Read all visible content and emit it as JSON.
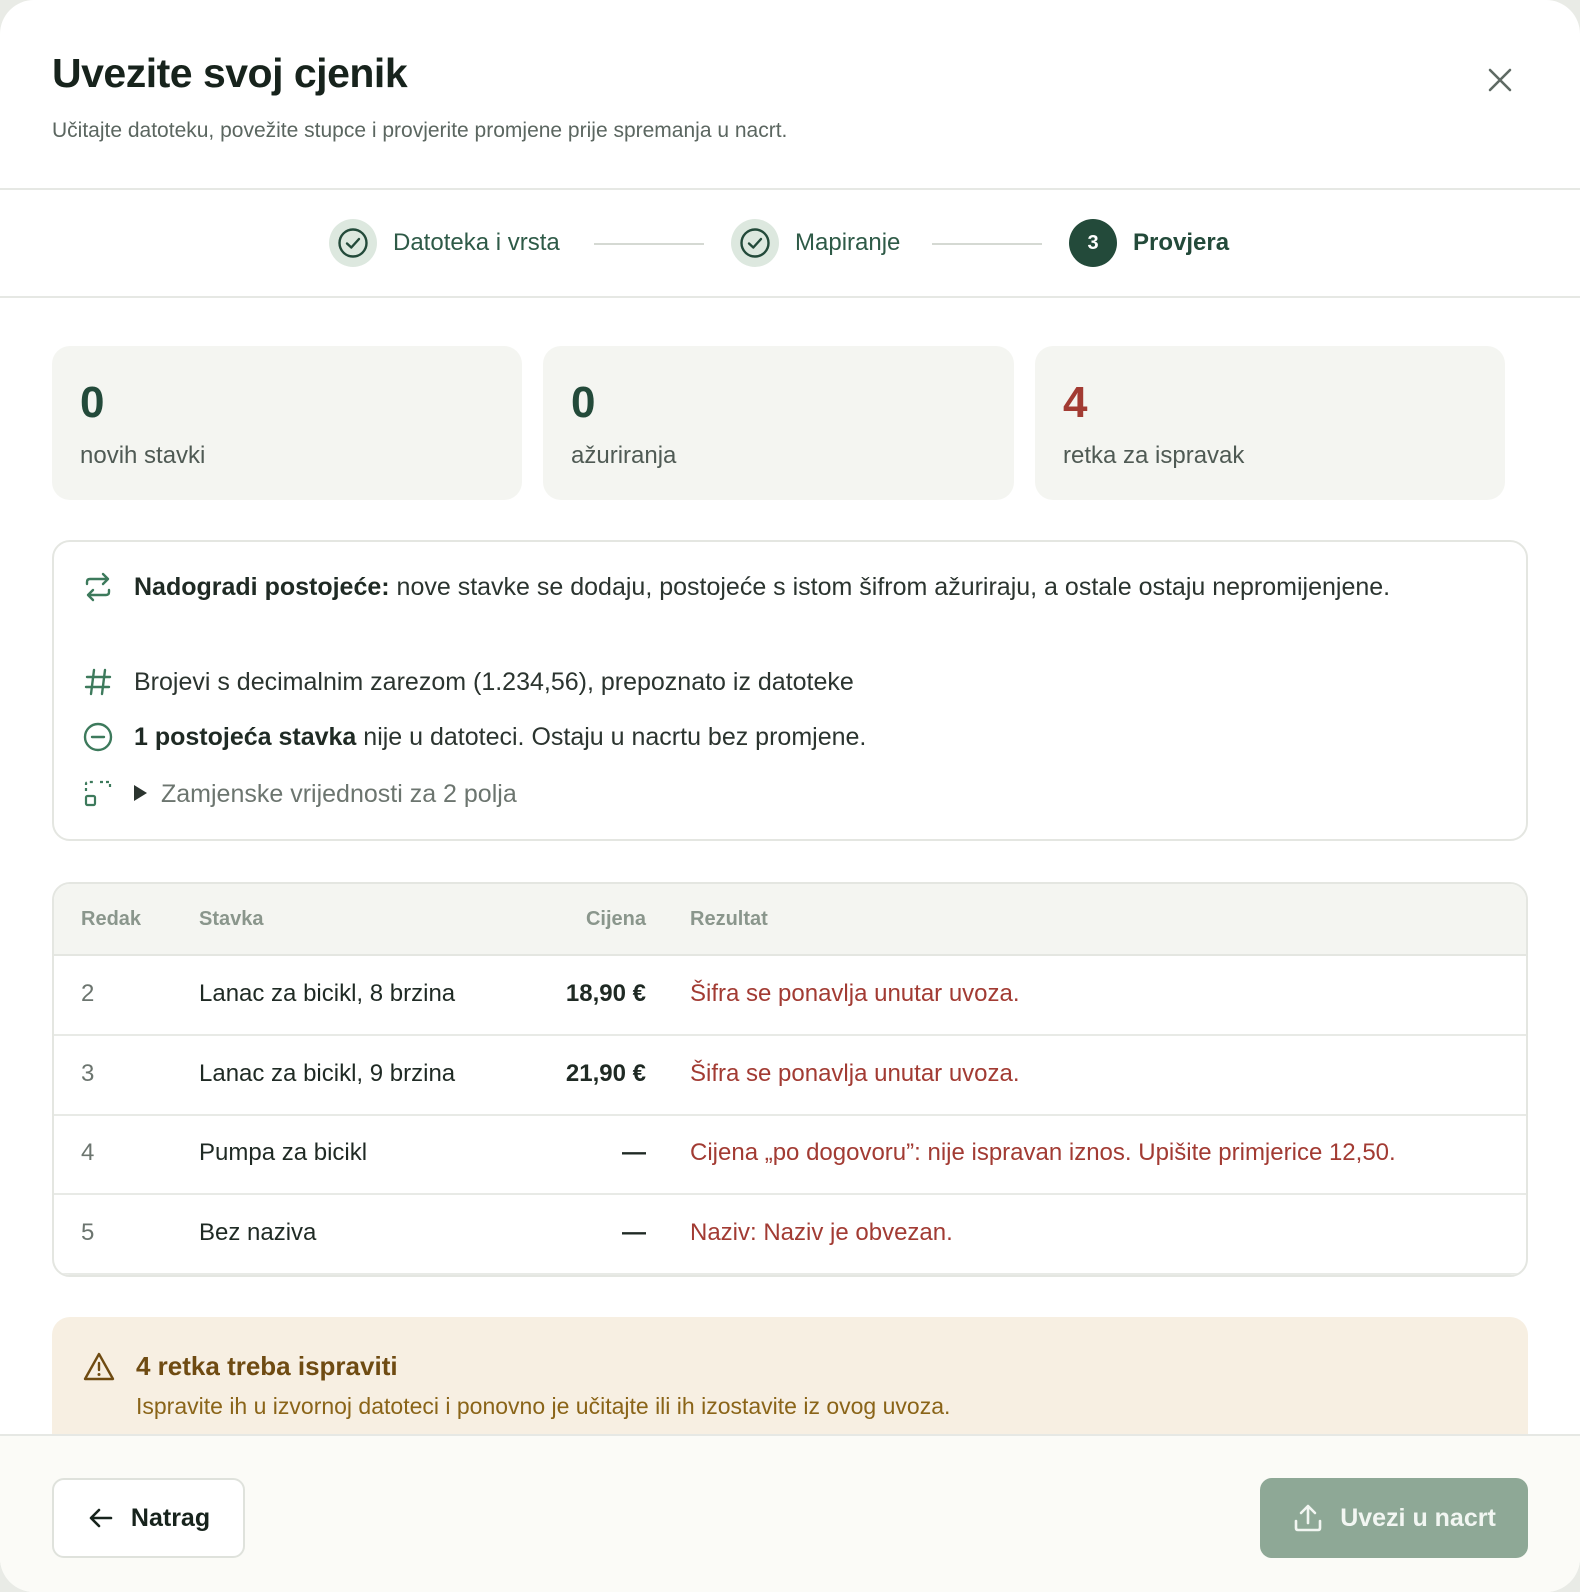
{
  "modal": {
    "title": "Uvezite svoj cjenik",
    "subtitle": "Učitajte datoteku, povežite stupce i provjerite promjene prije spremanja u nacrt.",
    "close_icon": "close-icon"
  },
  "stepper": {
    "steps": [
      {
        "label": "Datoteka i vrsta",
        "state": "done",
        "icon": "check-icon"
      },
      {
        "label": "Mapiranje",
        "state": "done",
        "icon": "check-icon"
      },
      {
        "label": "Provjera",
        "state": "active",
        "number": "3"
      }
    ]
  },
  "stats": [
    {
      "value": "0",
      "label": "novih stavki",
      "color": "#234a3a"
    },
    {
      "value": "0",
      "label": "ažuriranja",
      "color": "#234a3a"
    },
    {
      "value": "4",
      "label": "retka za ispravak",
      "color": "#a23b33"
    }
  ],
  "info": {
    "mode_bold": "Nadogradi postojeće:",
    "mode_text": " nove stavke se dodaju, postojeće s istom šifrom ažuriraju, a ostale ostaju nepromijenjene.",
    "numbers_text": "Brojevi s decimalnim zarezom (1.234,56), prepoznato iz datoteke",
    "missing_bold": "1 postojeća stavka",
    "missing_text": " nije u datoteci. Ostaju u nacrtu bez promjene.",
    "fallback_toggle": "Zamjenske vrijednosti za 2 polja",
    "icons": [
      "sync-icon",
      "hash-icon",
      "minus-circle-icon",
      "replace-icon",
      "triangle-right-icon"
    ]
  },
  "table": {
    "headers": {
      "row": "Redak",
      "item": "Stavka",
      "price": "Cijena",
      "result": "Rezultat"
    },
    "rows": [
      {
        "row": "2",
        "item": "Lanac za bicikl, 8 brzina",
        "price": "18,90 €",
        "result": "Šifra se ponavlja unutar uvoza."
      },
      {
        "row": "3",
        "item": "Lanac za bicikl, 9 brzina",
        "price": "21,90 €",
        "result": "Šifra se ponavlja unutar uvoza."
      },
      {
        "row": "4",
        "item": "Pumpa za bicikl",
        "price": "—",
        "result": "Cijena „po dogovoru”: nije ispravan iznos. Upišite primjerice 12,50."
      },
      {
        "row": "5",
        "item": "Bez naziva",
        "price": "—",
        "result": "Naziv: Naziv je obvezan."
      }
    ]
  },
  "warning": {
    "icon": "warning-icon",
    "title": "4 retka treba ispraviti",
    "text": "Ispravite ih u izvornoj datoteci i ponovno je učitajte ili ih izostavite iz ovog uvoza."
  },
  "footer": {
    "back_label": "Natrag",
    "back_icon": "arrow-left-icon",
    "import_label": "Uvezi u nacrt",
    "import_icon": "upload-icon"
  },
  "colors": {
    "brand": "#234a3a",
    "error": "#a23b33",
    "warning_bg": "#f7efe2",
    "disabled_button": "#8ea896"
  }
}
